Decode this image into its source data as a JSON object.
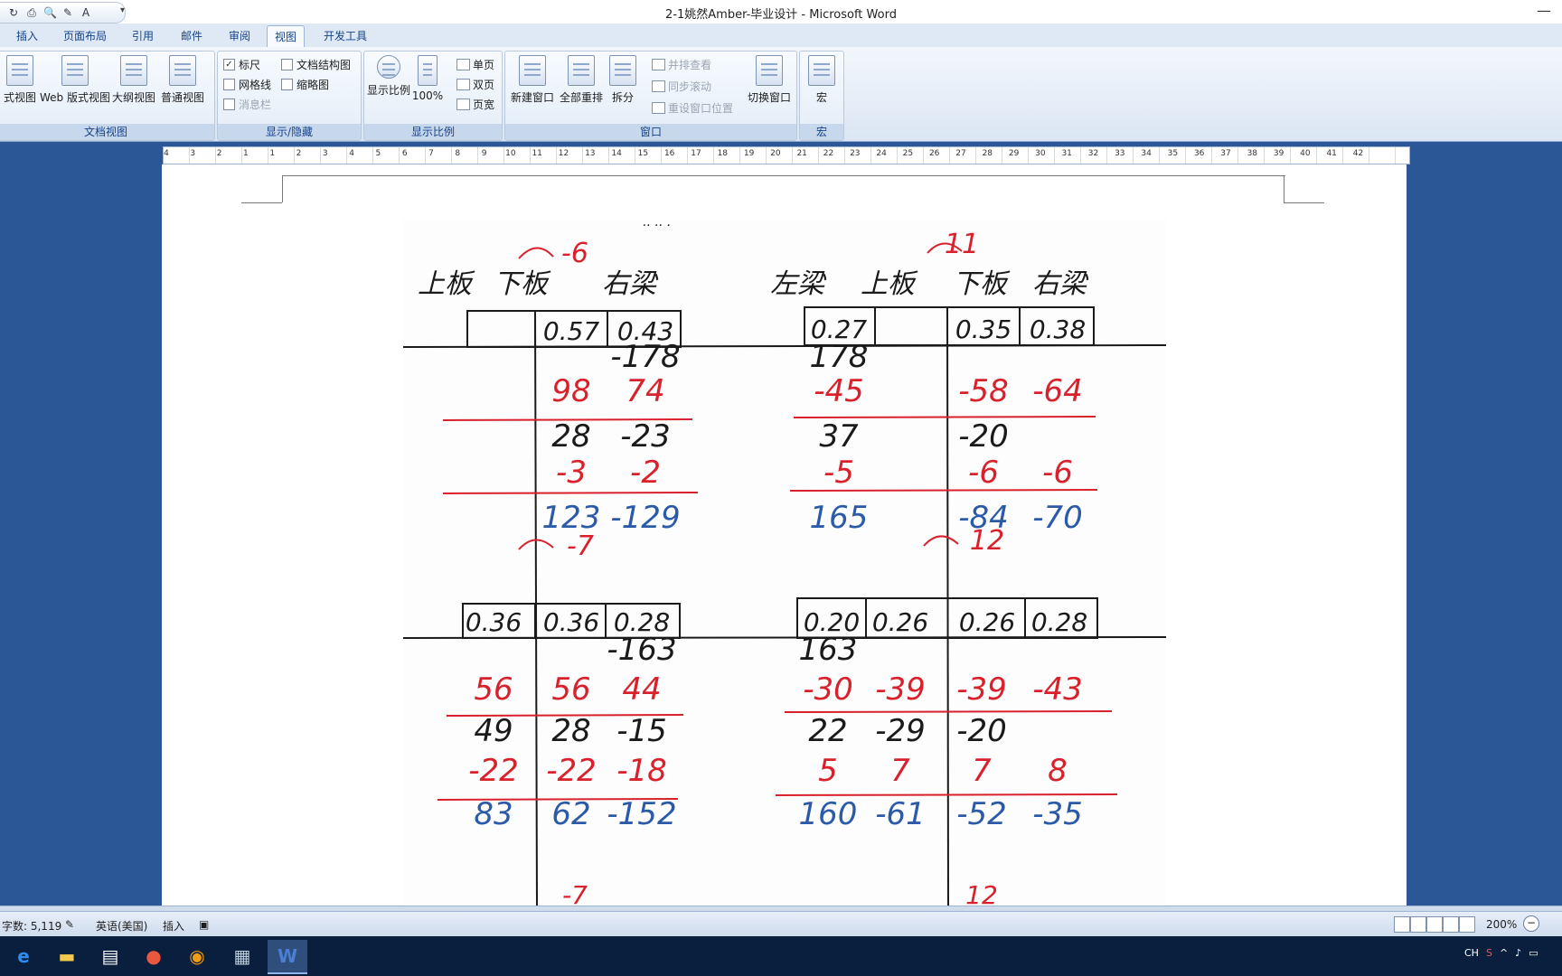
{
  "window": {
    "title": "2-1姚然Amber-毕业设计 - Microsoft Word"
  },
  "quick_access": {
    "more": "▾"
  },
  "tabs": [
    {
      "label": "插入"
    },
    {
      "label": "页面布局"
    },
    {
      "label": "引用"
    },
    {
      "label": "邮件"
    },
    {
      "label": "审阅"
    },
    {
      "label": "视图"
    },
    {
      "label": "开发工具"
    }
  ],
  "ribbon": {
    "doc_views": {
      "label": "文档视图",
      "buttons": [
        {
          "label": "式视图"
        },
        {
          "label": "Web 版式视图"
        },
        {
          "label": "大纲视图"
        },
        {
          "label": "普通视图"
        }
      ]
    },
    "show_hide": {
      "label": "显示/隐藏",
      "ruler": "标尺",
      "gridlines": "网格线",
      "message_bar": "消息栏",
      "doc_map": "文档结构图",
      "thumbnails": "缩略图"
    },
    "zoom": {
      "label": "显示比例",
      "zoom_btn": "显示比例",
      "pct100": "100%",
      "one_page": "单页",
      "two_pages": "双页",
      "page_width": "页宽"
    },
    "window": {
      "label": "窗口",
      "new_window": "新建窗口",
      "arrange_all": "全部重排",
      "split": "拆分",
      "side_by_side": "并排查看",
      "sync_scroll": "同步滚动",
      "reset_pos": "重设窗口位置",
      "switch": "切换窗口"
    },
    "macros": {
      "label": "宏",
      "btn": "宏"
    }
  },
  "ruler": {
    "labels": [
      "4",
      "3",
      "2",
      "1",
      "1",
      "2",
      "3",
      "4",
      "5",
      "6",
      "7",
      "8",
      "9",
      "10",
      "11",
      "12",
      "13",
      "14",
      "15",
      "16",
      "17",
      "18",
      "19",
      "20",
      "21",
      "22",
      "23",
      "24",
      "25",
      "26",
      "27",
      "28",
      "29",
      "30",
      "31",
      "32",
      "33",
      "34",
      "35",
      "36",
      "37",
      "38",
      "39",
      "40",
      "41",
      "42"
    ]
  },
  "scan": {
    "top_left": {
      "headers": [
        "上板",
        "下板",
        "右梁"
      ],
      "carry": "-6",
      "factors": [
        "0.57",
        "0.43"
      ],
      "rows": [
        {
          "cells": [
            "",
            "",
            "-178"
          ],
          "color": "black"
        },
        {
          "cells": [
            "",
            "98",
            "74"
          ],
          "color": "red"
        },
        {
          "cells": [
            "",
            "28",
            "-23"
          ],
          "color": "black"
        },
        {
          "cells": [
            "",
            "-3",
            "-2"
          ],
          "color": "red"
        },
        {
          "cells": [
            "",
            "123",
            "-129"
          ],
          "color": "blue"
        }
      ]
    },
    "top_right": {
      "headers": [
        "左梁",
        "上板",
        "下板",
        "右梁"
      ],
      "carry": "11",
      "factors": [
        "0.27",
        "",
        "0.35",
        "0.38"
      ],
      "rows": [
        {
          "cells": [
            "178",
            "",
            "",
            ""
          ],
          "color": "black"
        },
        {
          "cells": [
            "-45",
            "",
            "-58",
            "-64"
          ],
          "color": "red"
        },
        {
          "cells": [
            "37",
            "",
            "-20",
            ""
          ],
          "color": "black"
        },
        {
          "cells": [
            "-5",
            "",
            "-6",
            "-6"
          ],
          "color": "red"
        },
        {
          "cells": [
            "165",
            "",
            "-84",
            "-70"
          ],
          "color": "blue"
        }
      ]
    },
    "bottom_left": {
      "carry": "-7",
      "factors": [
        "0.36",
        "0.36",
        "0.28"
      ],
      "rows": [
        {
          "cells": [
            "",
            "",
            "-163"
          ],
          "color": "black"
        },
        {
          "cells": [
            "56",
            "56",
            "44"
          ],
          "color": "red"
        },
        {
          "cells": [
            "49",
            "28",
            "-15"
          ],
          "color": "black"
        },
        {
          "cells": [
            "-22",
            "-22",
            "-18"
          ],
          "color": "red"
        },
        {
          "cells": [
            "83",
            "62",
            "-152"
          ],
          "color": "blue"
        }
      ]
    },
    "bottom_right": {
      "carry": "12",
      "factors": [
        "0.20",
        "0.26",
        "0.26",
        "0.28"
      ],
      "rows": [
        {
          "cells": [
            "163",
            "",
            "",
            ""
          ],
          "color": "black"
        },
        {
          "cells": [
            "-30",
            "-39",
            "-39",
            "-43"
          ],
          "color": "red"
        },
        {
          "cells": [
            "22",
            "-29",
            "-20",
            ""
          ],
          "color": "black"
        },
        {
          "cells": [
            "5",
            "7",
            "7",
            "8"
          ],
          "color": "red"
        },
        {
          "cells": [
            "160",
            "-61",
            "-52",
            "-35"
          ],
          "color": "blue"
        }
      ]
    },
    "peek_bottom_left": "-7",
    "peek_bottom_right": "12",
    "peek_top": "··  ·· ·"
  },
  "status": {
    "word_count": "字数: 5,119",
    "language": "英语(美国)",
    "mode": "插入",
    "zoom": "200%"
  },
  "colors": {
    "black_ink": "#1a1a1a",
    "red_ink": "#d9212c",
    "blue_ink": "#2a5aa8"
  },
  "taskbar": {
    "tray_lang": "CH"
  }
}
